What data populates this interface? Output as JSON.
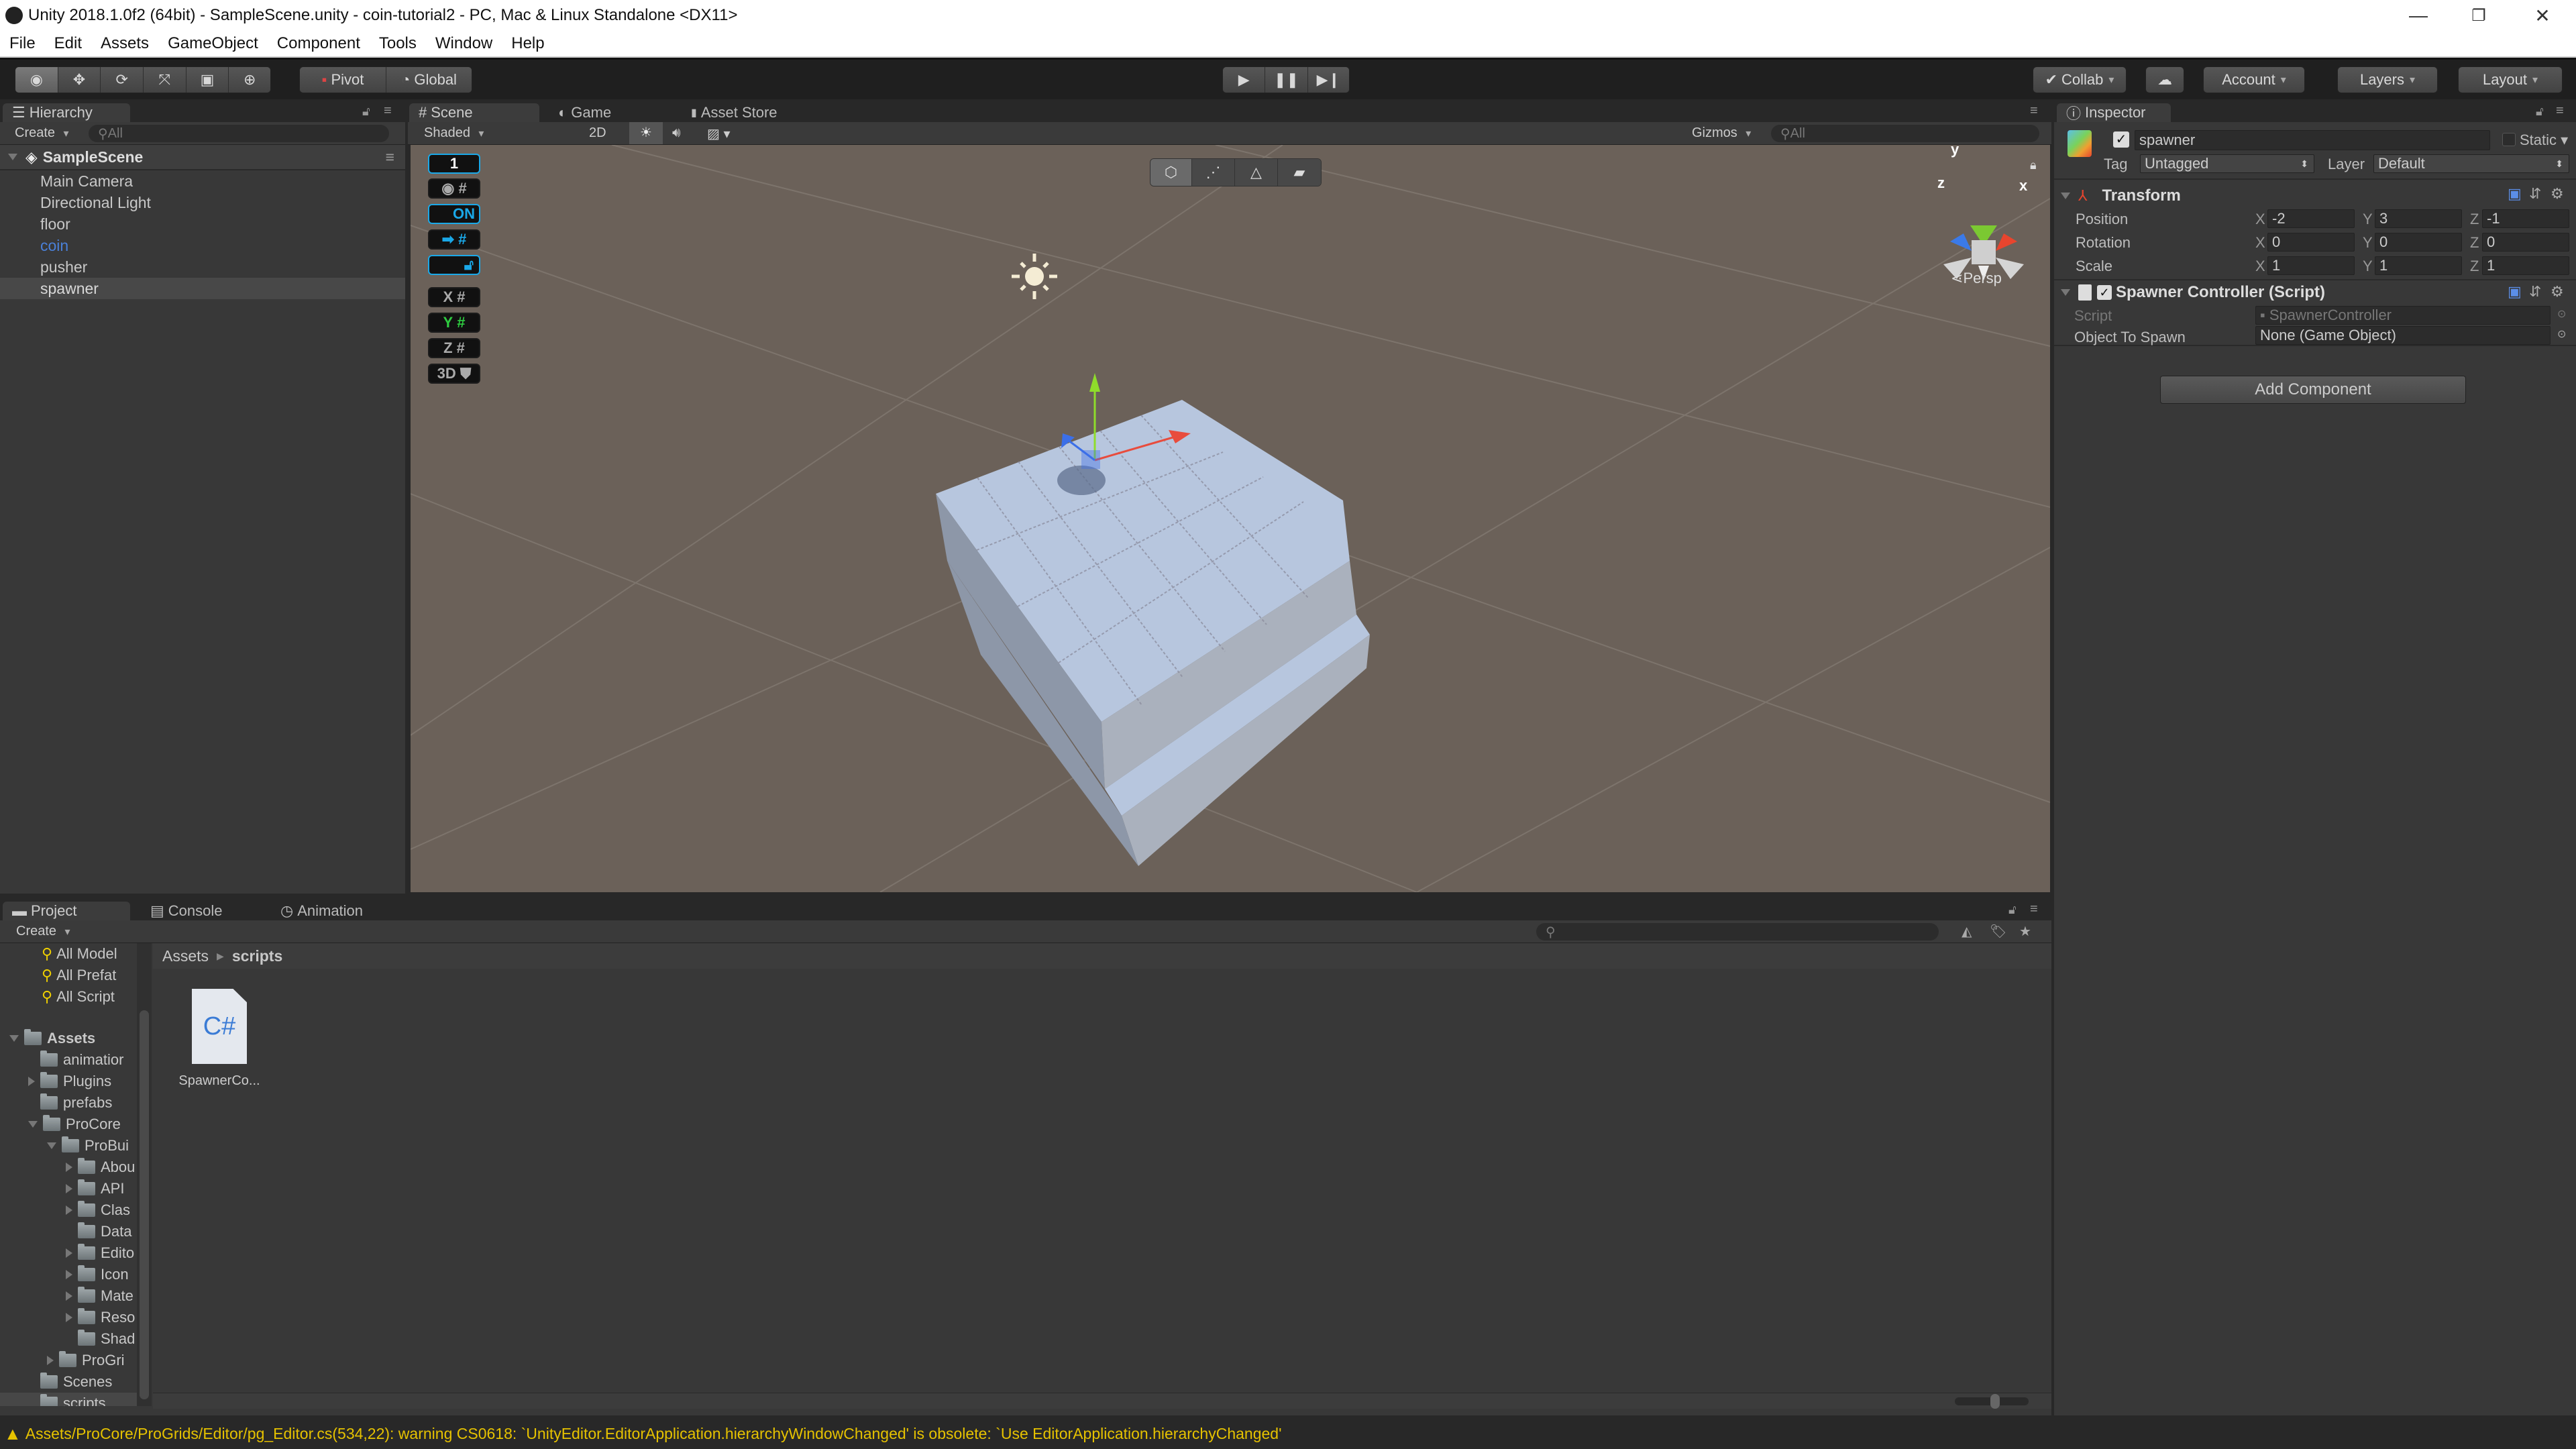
{
  "window": {
    "title": "Unity 2018.1.0f2 (64bit) - SampleScene.unity - coin-tutorial2 - PC, Mac & Linux Standalone <DX11>",
    "controls": [
      "minimize",
      "restore",
      "close"
    ]
  },
  "menu": [
    "File",
    "Edit",
    "Assets",
    "GameObject",
    "Component",
    "Tools",
    "Window",
    "Help"
  ],
  "toolbar": {
    "tools": [
      "view-tool",
      "move-tool",
      "rotate-tool",
      "scale-tool",
      "rect-tool",
      "transform-tool"
    ],
    "active_tool": "view-tool",
    "pivot_label": "Pivot",
    "global_label": "Global",
    "play": [
      "play",
      "pause",
      "step"
    ],
    "collab_label": "Collab",
    "account_label": "Account",
    "layers_label": "Layers",
    "layout_label": "Layout"
  },
  "hierarchy": {
    "tab_label": "Hierarchy",
    "create_label": "Create",
    "search_placeholder": "All",
    "scene_name": "SampleScene",
    "items": [
      {
        "label": "Main Camera",
        "color": "#c8c8c8",
        "selected": false
      },
      {
        "label": "Directional Light",
        "color": "#c8c8c8",
        "selected": false
      },
      {
        "label": "floor",
        "color": "#c8c8c8",
        "selected": false
      },
      {
        "label": "coin",
        "color": "#4a80d8",
        "selected": false
      },
      {
        "label": "pusher",
        "color": "#c8c8c8",
        "selected": false
      },
      {
        "label": "spawner",
        "color": "#d8d8d8",
        "selected": true
      }
    ]
  },
  "scene": {
    "tabs": [
      {
        "label": "Scene",
        "active": true
      },
      {
        "label": "Game",
        "active": false
      },
      {
        "label": "Asset Store",
        "active": false
      }
    ],
    "shading_mode": "Shaded",
    "mode_2d_label": "2D",
    "gizmos_label": "Gizmos",
    "search_placeholder": "All",
    "projection_label": "Persp",
    "axis_labels": {
      "x": "x",
      "y": "y",
      "z": "z"
    },
    "progrids": {
      "grid_size": "1",
      "snap_label": "ON",
      "axes": [
        "X",
        "Y",
        "Z"
      ],
      "active_axis": "Y",
      "mode_3d_label": "3D"
    },
    "probuilder_modes": [
      "object-mode",
      "vertex-mode",
      "edge-mode",
      "face-mode"
    ],
    "background_color": "#6b6159"
  },
  "inspector": {
    "tab_label": "Inspector",
    "object_name": "spawner",
    "active": true,
    "static_label": "Static",
    "tag_label": "Tag",
    "tag_value": "Untagged",
    "layer_label": "Layer",
    "layer_value": "Default",
    "transform": {
      "title": "Transform",
      "rows": [
        {
          "label": "Position",
          "x": "-2",
          "y": "3",
          "z": "-1"
        },
        {
          "label": "Rotation",
          "x": "0",
          "y": "0",
          "z": "0"
        },
        {
          "label": "Scale",
          "x": "1",
          "y": "1",
          "z": "1"
        }
      ]
    },
    "script_component": {
      "title": "Spawner Controller (Script)",
      "enabled": true,
      "script_label": "Script",
      "script_value": "SpawnerController",
      "object_to_spawn_label": "Object To Spawn",
      "object_to_spawn_value": "None (Game Object)"
    },
    "add_component_label": "Add Component"
  },
  "project": {
    "tabs": [
      {
        "label": "Project",
        "active": true
      },
      {
        "label": "Console",
        "active": false
      },
      {
        "label": "Animation",
        "active": false
      }
    ],
    "create_label": "Create",
    "favorites": [
      "All Model",
      "All Prefat",
      "All Script"
    ],
    "tree": [
      {
        "label": "Assets",
        "depth": 0,
        "arrow": "down",
        "bold": true
      },
      {
        "label": "animatior",
        "depth": 1,
        "arrow": "none"
      },
      {
        "label": "Plugins",
        "depth": 1,
        "arrow": "right"
      },
      {
        "label": "prefabs",
        "depth": 1,
        "arrow": "none"
      },
      {
        "label": "ProCore",
        "depth": 1,
        "arrow": "down"
      },
      {
        "label": "ProBui",
        "depth": 2,
        "arrow": "down"
      },
      {
        "label": "Abou",
        "depth": 3,
        "arrow": "right"
      },
      {
        "label": "API",
        "depth": 3,
        "arrow": "right"
      },
      {
        "label": "Clas",
        "depth": 3,
        "arrow": "right"
      },
      {
        "label": "Data",
        "depth": 3,
        "arrow": "none"
      },
      {
        "label": "Edito",
        "depth": 3,
        "arrow": "right"
      },
      {
        "label": "Icon",
        "depth": 3,
        "arrow": "right"
      },
      {
        "label": "Mate",
        "depth": 3,
        "arrow": "right"
      },
      {
        "label": "Reso",
        "depth": 3,
        "arrow": "right"
      },
      {
        "label": "Shad",
        "depth": 3,
        "arrow": "none"
      },
      {
        "label": "ProGri",
        "depth": 2,
        "arrow": "right"
      },
      {
        "label": "Scenes",
        "depth": 1,
        "arrow": "none"
      },
      {
        "label": "scripts",
        "depth": 1,
        "arrow": "none",
        "selected": true
      }
    ],
    "breadcrumb": [
      "Assets",
      "scripts"
    ],
    "files": [
      {
        "label": "SpawnerCo...",
        "icon_text": "C#"
      }
    ],
    "zoom_slider": 0.55
  },
  "status": {
    "message": "Assets/ProCore/ProGrids/Editor/pg_Editor.cs(534,22): warning CS0618: `UnityEditor.EditorApplication.hierarchyWindowChanged' is obsolete: `Use EditorApplication.hierarchyChanged'",
    "color": "#e6c200"
  }
}
